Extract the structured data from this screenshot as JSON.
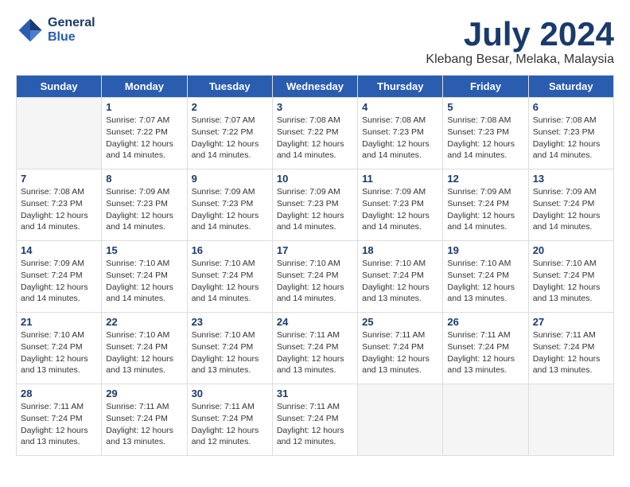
{
  "header": {
    "logo_line1": "General",
    "logo_line2": "Blue",
    "month": "July 2024",
    "location": "Klebang Besar, Melaka, Malaysia"
  },
  "weekdays": [
    "Sunday",
    "Monday",
    "Tuesday",
    "Wednesday",
    "Thursday",
    "Friday",
    "Saturday"
  ],
  "weeks": [
    [
      {
        "day": "",
        "empty": true
      },
      {
        "day": "1",
        "sunrise": "7:07 AM",
        "sunset": "7:22 PM",
        "daylight": "12 hours and 14 minutes."
      },
      {
        "day": "2",
        "sunrise": "7:07 AM",
        "sunset": "7:22 PM",
        "daylight": "12 hours and 14 minutes."
      },
      {
        "day": "3",
        "sunrise": "7:08 AM",
        "sunset": "7:22 PM",
        "daylight": "12 hours and 14 minutes."
      },
      {
        "day": "4",
        "sunrise": "7:08 AM",
        "sunset": "7:23 PM",
        "daylight": "12 hours and 14 minutes."
      },
      {
        "day": "5",
        "sunrise": "7:08 AM",
        "sunset": "7:23 PM",
        "daylight": "12 hours and 14 minutes."
      },
      {
        "day": "6",
        "sunrise": "7:08 AM",
        "sunset": "7:23 PM",
        "daylight": "12 hours and 14 minutes."
      }
    ],
    [
      {
        "day": "7",
        "sunrise": "7:08 AM",
        "sunset": "7:23 PM",
        "daylight": "12 hours and 14 minutes."
      },
      {
        "day": "8",
        "sunrise": "7:09 AM",
        "sunset": "7:23 PM",
        "daylight": "12 hours and 14 minutes."
      },
      {
        "day": "9",
        "sunrise": "7:09 AM",
        "sunset": "7:23 PM",
        "daylight": "12 hours and 14 minutes."
      },
      {
        "day": "10",
        "sunrise": "7:09 AM",
        "sunset": "7:23 PM",
        "daylight": "12 hours and 14 minutes."
      },
      {
        "day": "11",
        "sunrise": "7:09 AM",
        "sunset": "7:23 PM",
        "daylight": "12 hours and 14 minutes."
      },
      {
        "day": "12",
        "sunrise": "7:09 AM",
        "sunset": "7:24 PM",
        "daylight": "12 hours and 14 minutes."
      },
      {
        "day": "13",
        "sunrise": "7:09 AM",
        "sunset": "7:24 PM",
        "daylight": "12 hours and 14 minutes."
      }
    ],
    [
      {
        "day": "14",
        "sunrise": "7:09 AM",
        "sunset": "7:24 PM",
        "daylight": "12 hours and 14 minutes."
      },
      {
        "day": "15",
        "sunrise": "7:10 AM",
        "sunset": "7:24 PM",
        "daylight": "12 hours and 14 minutes."
      },
      {
        "day": "16",
        "sunrise": "7:10 AM",
        "sunset": "7:24 PM",
        "daylight": "12 hours and 14 minutes."
      },
      {
        "day": "17",
        "sunrise": "7:10 AM",
        "sunset": "7:24 PM",
        "daylight": "12 hours and 14 minutes."
      },
      {
        "day": "18",
        "sunrise": "7:10 AM",
        "sunset": "7:24 PM",
        "daylight": "12 hours and 13 minutes."
      },
      {
        "day": "19",
        "sunrise": "7:10 AM",
        "sunset": "7:24 PM",
        "daylight": "12 hours and 13 minutes."
      },
      {
        "day": "20",
        "sunrise": "7:10 AM",
        "sunset": "7:24 PM",
        "daylight": "12 hours and 13 minutes."
      }
    ],
    [
      {
        "day": "21",
        "sunrise": "7:10 AM",
        "sunset": "7:24 PM",
        "daylight": "12 hours and 13 minutes."
      },
      {
        "day": "22",
        "sunrise": "7:10 AM",
        "sunset": "7:24 PM",
        "daylight": "12 hours and 13 minutes."
      },
      {
        "day": "23",
        "sunrise": "7:10 AM",
        "sunset": "7:24 PM",
        "daylight": "12 hours and 13 minutes."
      },
      {
        "day": "24",
        "sunrise": "7:11 AM",
        "sunset": "7:24 PM",
        "daylight": "12 hours and 13 minutes."
      },
      {
        "day": "25",
        "sunrise": "7:11 AM",
        "sunset": "7:24 PM",
        "daylight": "12 hours and 13 minutes."
      },
      {
        "day": "26",
        "sunrise": "7:11 AM",
        "sunset": "7:24 PM",
        "daylight": "12 hours and 13 minutes."
      },
      {
        "day": "27",
        "sunrise": "7:11 AM",
        "sunset": "7:24 PM",
        "daylight": "12 hours and 13 minutes."
      }
    ],
    [
      {
        "day": "28",
        "sunrise": "7:11 AM",
        "sunset": "7:24 PM",
        "daylight": "12 hours and 13 minutes."
      },
      {
        "day": "29",
        "sunrise": "7:11 AM",
        "sunset": "7:24 PM",
        "daylight": "12 hours and 13 minutes."
      },
      {
        "day": "30",
        "sunrise": "7:11 AM",
        "sunset": "7:24 PM",
        "daylight": "12 hours and 12 minutes."
      },
      {
        "day": "31",
        "sunrise": "7:11 AM",
        "sunset": "7:24 PM",
        "daylight": "12 hours and 12 minutes."
      },
      {
        "day": "",
        "empty": true
      },
      {
        "day": "",
        "empty": true
      },
      {
        "day": "",
        "empty": true
      }
    ]
  ]
}
